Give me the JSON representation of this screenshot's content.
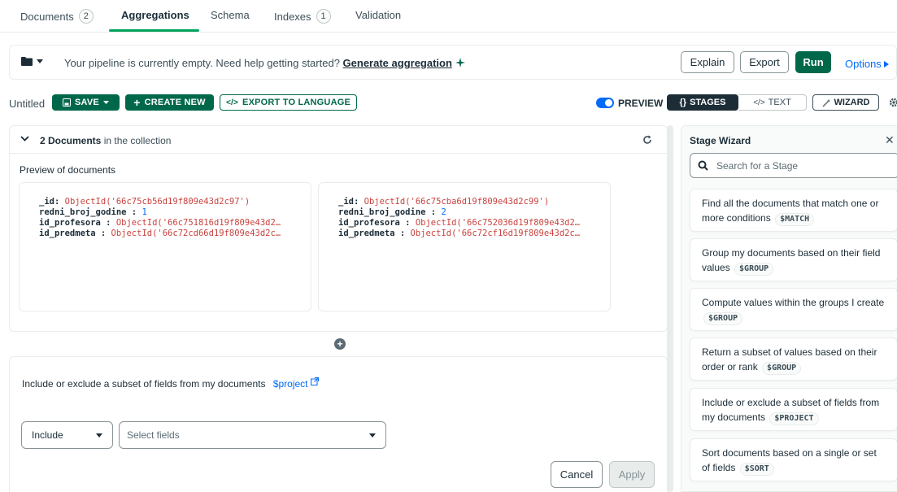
{
  "tabs": [
    {
      "label": "Documents",
      "count": "2"
    },
    {
      "label": "Aggregations"
    },
    {
      "label": "Schema"
    },
    {
      "label": "Indexes",
      "count": "1"
    },
    {
      "label": "Validation"
    }
  ],
  "pipeline": {
    "empty_message": "Your pipeline is currently empty. Need help getting started?",
    "generate_link": "Generate aggregation",
    "explain_label": "Explain",
    "export_label": "Export",
    "run_label": "Run",
    "options_label": "Options"
  },
  "toolbar": {
    "name": "Untitled",
    "save_label": "SAVE",
    "create_new_label": "CREATE NEW",
    "export_language_label": "EXPORT TO LANGUAGE",
    "preview_label": "PREVIEW",
    "stages_label": "STAGES",
    "text_label": "TEXT",
    "wizard_label": "WIZARD"
  },
  "documents": {
    "count_label": "2 Documents",
    "suffix": "in the collection",
    "preview_label": "Preview of documents",
    "items": [
      {
        "id_key": "_id:",
        "id_val": "ObjectId('66c75cb56d19f809e43d2c97')",
        "f1_key": "redni_broj_godine :",
        "f1_val": "1",
        "f2_key": "id_profesora :",
        "f2_val": "ObjectId('66c751816d19f809e43d2…",
        "f3_key": "id_predmeta :",
        "f3_val": "ObjectId('66c72cd66d19f809e43d2c…"
      },
      {
        "id_key": "_id:",
        "id_val": "ObjectId('66c75cba6d19f809e43d2c99')",
        "f1_key": "redni_broj_godine :",
        "f1_val": "2",
        "f2_key": "id_profesora :",
        "f2_val": "ObjectId('66c752036d19f809e43d2…",
        "f3_key": "id_predmeta :",
        "f3_val": "ObjectId('66c72cf16d19f809e43d2c…"
      }
    ]
  },
  "stage": {
    "description": "Include or exclude a subset of fields from my documents",
    "link": "$project",
    "mode_value": "Include",
    "fields_placeholder": "Select fields",
    "cancel_label": "Cancel",
    "apply_label": "Apply"
  },
  "wizard": {
    "title": "Stage Wizard",
    "search_placeholder": "Search for a Stage",
    "cards": [
      {
        "text": "Find all the documents that match one or more conditions",
        "badge": "$MATCH"
      },
      {
        "text": "Group my documents based on their field values",
        "badge": "$GROUP"
      },
      {
        "text": "Compute values within the groups I create",
        "badge": "$GROUP"
      },
      {
        "text": "Return a subset of values based on their order or rank",
        "badge": "$GROUP"
      },
      {
        "text": "Include or exclude a subset of fields from my documents",
        "badge": "$PROJECT"
      },
      {
        "text": "Sort documents based on a single or set of fields",
        "badge": "$SORT"
      }
    ]
  },
  "colors": {
    "brand_green": "#00684a",
    "accent_green": "#00a35c",
    "link_blue": "#016bf8",
    "value_red": "#c9433e"
  }
}
